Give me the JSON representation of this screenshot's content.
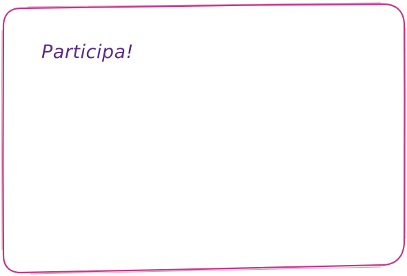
{
  "card": {
    "title": "Participa!",
    "border_color": "#c8338c",
    "title_color": "#5b2a86"
  }
}
